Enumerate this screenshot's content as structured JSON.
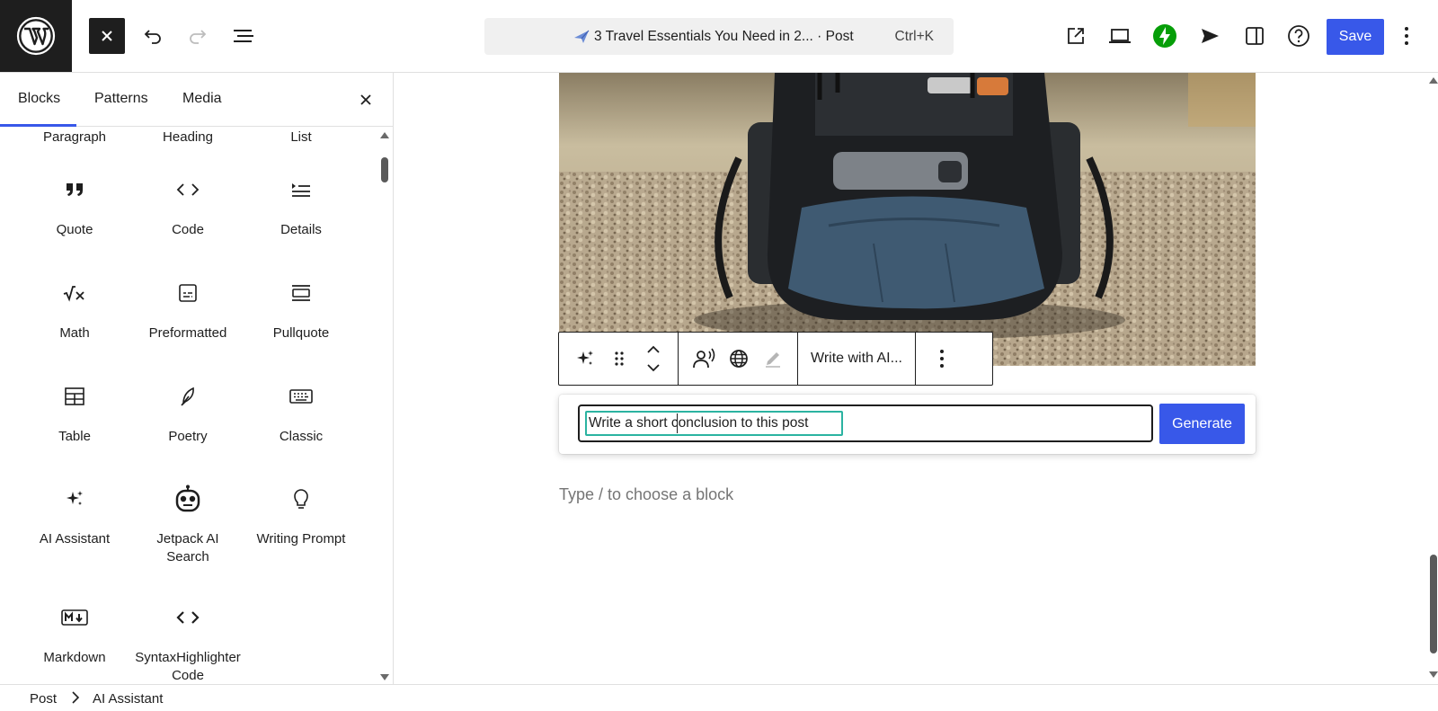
{
  "topbar": {
    "document_title": "3 Travel Essentials You Need in 2... · Post",
    "shortcut": "Ctrl+K",
    "save_label": "Save"
  },
  "inserter": {
    "tabs": [
      "Blocks",
      "Patterns",
      "Media"
    ],
    "active_tab": "Blocks",
    "partial_top_row": [
      "Paragraph",
      "Heading",
      "List"
    ],
    "blocks": [
      {
        "label": "Quote",
        "icon": "quote-icon"
      },
      {
        "label": "Code",
        "icon": "code-icon"
      },
      {
        "label": "Details",
        "icon": "details-icon"
      },
      {
        "label": "Math",
        "icon": "math-icon"
      },
      {
        "label": "Preformatted",
        "icon": "preformatted-icon"
      },
      {
        "label": "Pullquote",
        "icon": "pullquote-icon"
      },
      {
        "label": "Table",
        "icon": "table-icon"
      },
      {
        "label": "Poetry",
        "icon": "poetry-icon"
      },
      {
        "label": "Classic",
        "icon": "keyboard-icon"
      },
      {
        "label": "AI Assistant",
        "icon": "sparkles-icon"
      },
      {
        "label": "Jetpack AI Search",
        "icon": "robot-icon"
      },
      {
        "label": "Writing Prompt",
        "icon": "lightbulb-icon"
      },
      {
        "label": "Markdown",
        "icon": "markdown-icon"
      },
      {
        "label": "SyntaxHighlighter Code",
        "icon": "code-icon"
      }
    ]
  },
  "canvas": {
    "block_toolbar": {
      "write_with_ai_label": "Write with AI..."
    },
    "ai_assistant": {
      "prompt_value": "Write a short conclusion to this post",
      "generate_label": "Generate"
    },
    "empty_block_placeholder": "Type / to choose a block"
  },
  "footer": {
    "breadcrumb": [
      "Post",
      "AI Assistant"
    ]
  },
  "colors": {
    "accent": "#3858e9",
    "jetpack_green": "#069e08",
    "focus_teal": "#2bb3a1",
    "dark": "#1e1e1e"
  }
}
